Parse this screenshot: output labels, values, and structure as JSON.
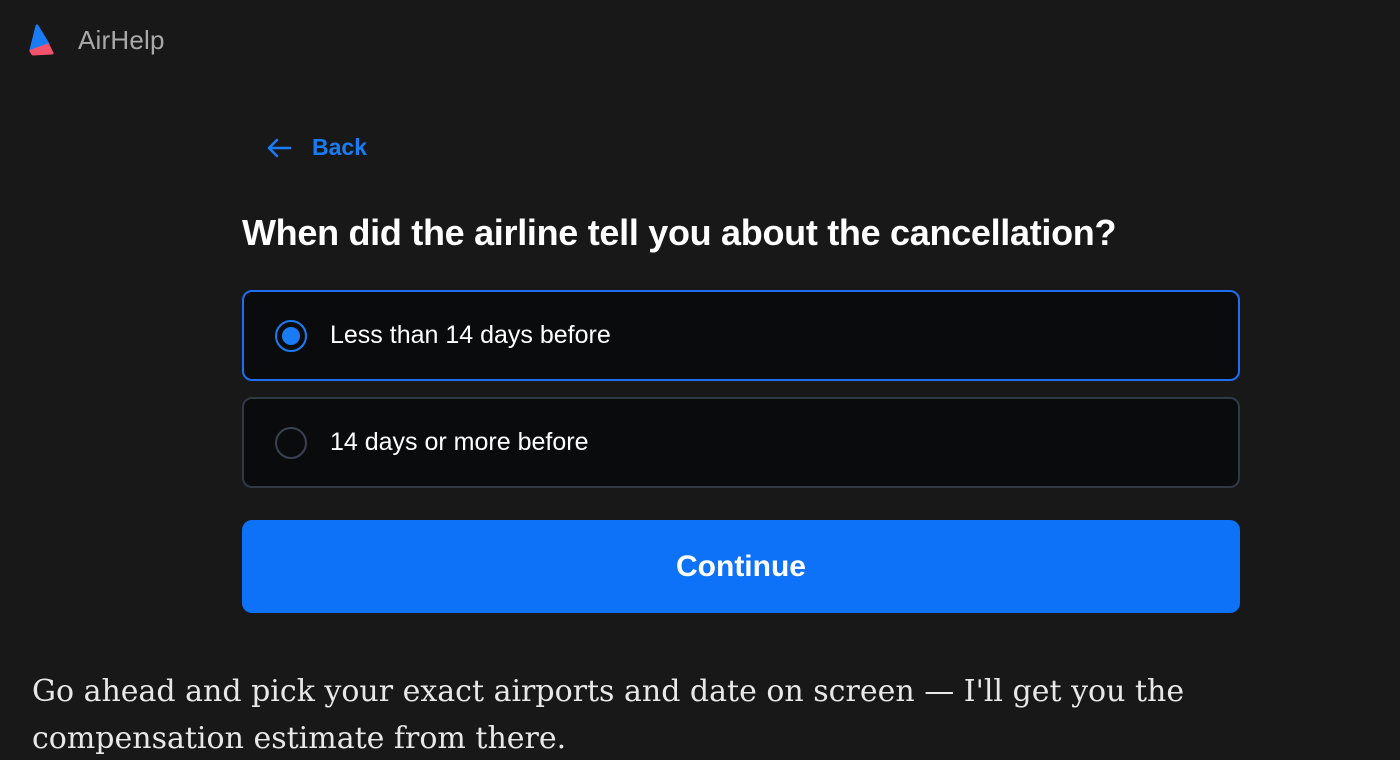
{
  "brand": {
    "name": "AirHelp",
    "logo_icon": "airhelp-logo-icon",
    "colors": {
      "logo_blue": "#1a7cf4",
      "logo_red": "#f2536a"
    }
  },
  "navigation": {
    "back_label": "Back",
    "back_icon": "arrow-left-icon"
  },
  "form": {
    "question": "When did the airline tell you about the cancellation?",
    "options": [
      {
        "label": "Less than 14 days before",
        "selected": true
      },
      {
        "label": "14 days or more before",
        "selected": false
      }
    ],
    "continue_label": "Continue"
  },
  "chat": {
    "message": "Go ahead and pick your exact airports and date on screen — I'll get you the compensation estimate from there."
  },
  "colors": {
    "background": "#181818",
    "accent": "#0d72f7",
    "option_background": "#0a0b0d",
    "option_border": "#313846",
    "selected_border": "#1d6ff0"
  }
}
